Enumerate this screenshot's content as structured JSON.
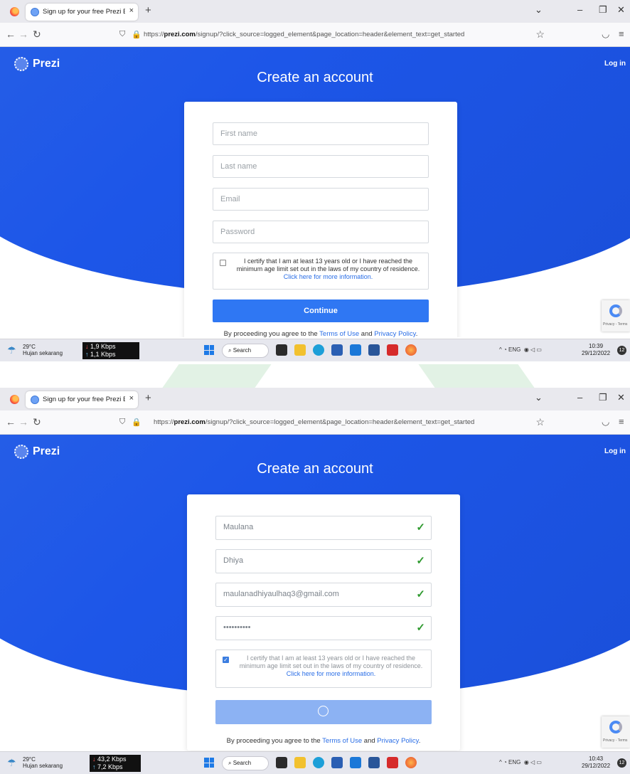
{
  "browser": {
    "tab_title": "Sign up for your free Prezi Basic",
    "tab_close": "×",
    "new_tab": "+",
    "url_prefix": "https://",
    "url_domain": "prezi.com",
    "url_path": "/signup/?click_source=logged_element&page_location=header&element_text=get_started"
  },
  "page": {
    "logo": "Prezi",
    "login": "Log in",
    "heading": "Create an account",
    "placeholders": {
      "first_name": "First name",
      "last_name": "Last name",
      "email": "Email",
      "password": "Password"
    },
    "certify_text": "I certify that I am at least 13 years old or I have reached the minimum age limit set out in the laws of my country of residence.",
    "certify_link": "Click here for more information.",
    "continue_label": "Continue",
    "agree_prefix": "By proceeding you agree to the",
    "terms": "Terms of Use",
    "agree_and": "and",
    "privacy": "Privacy Policy",
    "agree_suffix": ".",
    "recaptcha": "Privacy - Terms"
  },
  "filled": {
    "first_name": "Maulana",
    "last_name": "Dhiya",
    "email": "maulanadhiyaulhaq3@gmail.com",
    "password": "••••••••••",
    "checked": true
  },
  "taskbar1": {
    "temp": "29°C",
    "weather": "Hujan sekarang",
    "down": "1,9 Kbps",
    "up": "1,1 Kbps",
    "search": "Search",
    "lang": "ENG",
    "time": "10:39",
    "date": "29/12/2022",
    "badge": "12"
  },
  "taskbar2": {
    "temp": "29°C",
    "weather": "Hujan sekarang",
    "down": "43,2 Kbps",
    "up": "7,2 Kbps",
    "search": "Search",
    "lang": "ENG",
    "time": "10:43",
    "date": "29/12/2022",
    "badge": "12"
  },
  "icons": [
    "firefox-icon",
    "back-icon",
    "forward-icon",
    "reload-icon",
    "shield-icon",
    "lock-icon",
    "star-icon",
    "pocket-icon",
    "menu-icon",
    "checkmark-icon",
    "spinner-icon",
    "recaptcha-icon",
    "weather-icon",
    "windows-start-icon",
    "search-icon"
  ],
  "colors": {
    "brand_blue": "#1d56e8",
    "button_blue": "#2f77f3",
    "check_green": "#2f9a2f"
  }
}
